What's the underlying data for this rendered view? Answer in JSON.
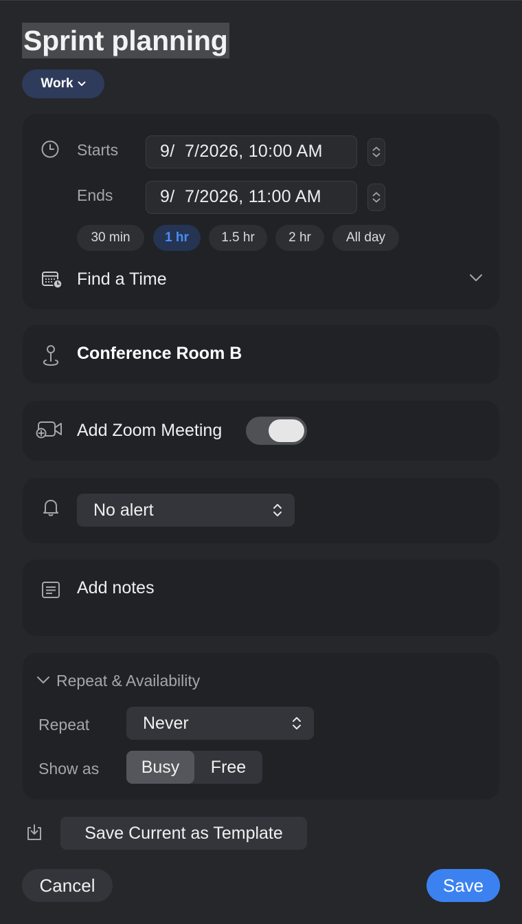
{
  "event": {
    "title": "Sprint planning",
    "calendar": "Work"
  },
  "time": {
    "starts_label": "Starts",
    "starts_value": "9/  7/2026, 10:00 AM",
    "ends_label": "Ends",
    "ends_value": "9/  7/2026, 11:00 AM",
    "durations": [
      "30 min",
      "1 hr",
      "1.5 hr",
      "2 hr",
      "All day"
    ],
    "active_duration": "1 hr",
    "find_time_label": "Find a Time"
  },
  "location": {
    "value": "Conference Room B"
  },
  "zoom": {
    "label": "Add Zoom Meeting",
    "enabled": true
  },
  "alert": {
    "value": "No alert"
  },
  "notes": {
    "placeholder": "Add notes"
  },
  "repeat_section": {
    "header": "Repeat & Availability",
    "repeat_label": "Repeat",
    "repeat_value": "Never",
    "show_as_label": "Show as",
    "show_as_options": [
      "Busy",
      "Free"
    ],
    "show_as_selected": "Busy"
  },
  "actions": {
    "template_label": "Save Current as Template",
    "cancel_label": "Cancel",
    "save_label": "Save"
  },
  "colors": {
    "background": "#26272b",
    "card": "#212226",
    "accent": "#3b82f0",
    "calendar_pill": "#2f3b5a"
  }
}
